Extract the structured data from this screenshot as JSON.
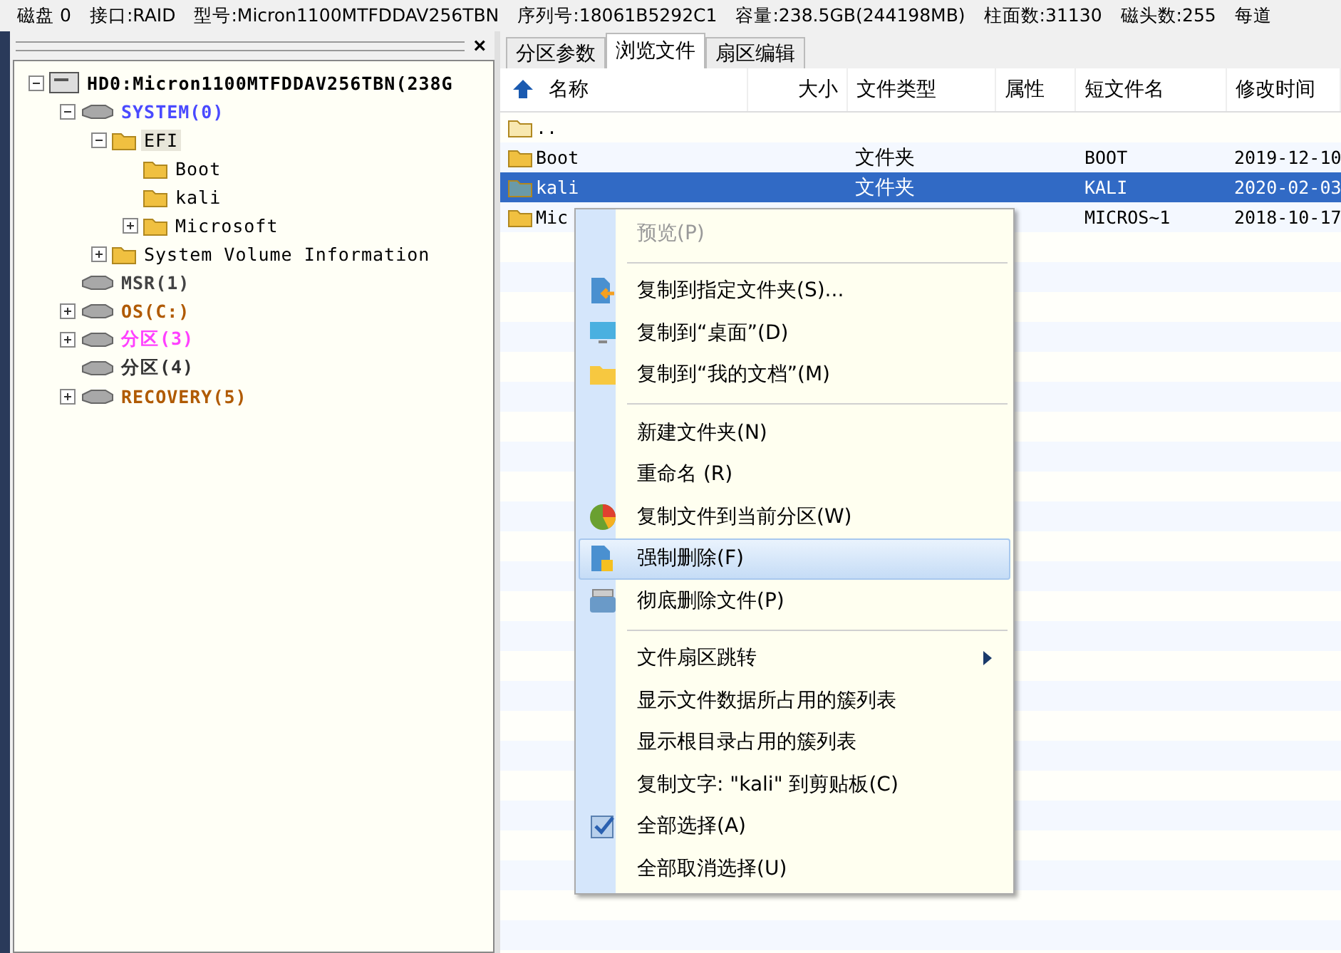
{
  "disk_info": [
    "磁盘 0",
    "接口:RAID",
    "型号:Micron1100MTFDDAV256TBN",
    "序列号:18061B5292C1",
    "容量:238.5GB(244198MB)",
    "柱面数:31130",
    "磁头数:255",
    "每道"
  ],
  "left_panel": {
    "close": "×"
  },
  "tree": [
    {
      "label": "HD0:Micron1100MTFDDAV256TBN(238G",
      "kind": "disk",
      "expanded": true,
      "selected": false,
      "children": [
        {
          "label": "SYSTEM(0)",
          "kind": "partition",
          "color": "#4a4aff",
          "expanded": true,
          "selected": false,
          "children": [
            {
              "label": "EFI",
              "kind": "folder",
              "expanded": true,
              "selected": true,
              "children": [
                {
                  "label": "Boot",
                  "kind": "folder",
                  "selected": false
                },
                {
                  "label": "kali",
                  "kind": "folder",
                  "selected": false
                },
                {
                  "label": "Microsoft",
                  "kind": "folder",
                  "expanded": false,
                  "selected": false
                }
              ]
            },
            {
              "label": "System Volume Information",
              "kind": "folder",
              "expanded": false,
              "selected": false
            }
          ]
        },
        {
          "label": "MSR(1)",
          "kind": "partition",
          "color": "#444444",
          "selected": false
        },
        {
          "label": "OS(C:)",
          "kind": "partition",
          "color": "#b05a00",
          "expanded": false,
          "selected": false
        },
        {
          "label": "分区(3)",
          "kind": "partition",
          "color": "#ff40ff",
          "expanded": false,
          "selected": false
        },
        {
          "label": "分区(4)",
          "kind": "partition",
          "color": "#333333",
          "selected": false
        },
        {
          "label": "RECOVERY(5)",
          "kind": "partition",
          "color": "#b05a00",
          "expanded": false,
          "selected": false
        }
      ]
    }
  ],
  "tabs": [
    {
      "label": "分区参数",
      "selected": false
    },
    {
      "label": "浏览文件",
      "selected": true
    },
    {
      "label": "扇区编辑",
      "selected": false
    }
  ],
  "table": {
    "columns": [
      "名称",
      "大小",
      "文件类型",
      "属性",
      "短文件名",
      "修改时间"
    ],
    "rows": [
      {
        "name": "..",
        "kind": "parent",
        "selected": false
      },
      {
        "name": "Boot",
        "kind": "folder",
        "type": "文件夹",
        "short_name": "BOOT",
        "modified": "2019-12-10",
        "selected": false
      },
      {
        "name": "kali",
        "kind": "folder",
        "type": "文件夹",
        "short_name": "KALI",
        "modified": "2020-02-03",
        "selected": true
      },
      {
        "name": "Mic",
        "kind": "folder",
        "short_name": "MICROS~1",
        "modified": "2018-10-17",
        "selected": false
      }
    ]
  },
  "context_menu": [
    {
      "kind": "item",
      "label": "预览(P)",
      "disabled": true,
      "selected": false
    },
    {
      "kind": "separator"
    },
    {
      "kind": "item",
      "label": "复制到指定文件夹(S)...",
      "disabled": false,
      "selected": false
    },
    {
      "kind": "item",
      "label": "复制到“桌面”(D)",
      "disabled": false,
      "selected": false
    },
    {
      "kind": "item",
      "label": "复制到“我的文档”(M)",
      "disabled": false,
      "selected": false
    },
    {
      "kind": "separator"
    },
    {
      "kind": "item",
      "label": "新建文件夹(N)",
      "disabled": false,
      "selected": false
    },
    {
      "kind": "item",
      "label": "重命名 (R)",
      "disabled": false,
      "selected": false
    },
    {
      "kind": "item",
      "label": "复制文件到当前分区(W)",
      "disabled": false,
      "selected": false
    },
    {
      "kind": "item",
      "label": "强制删除(F)",
      "disabled": false,
      "selected": true
    },
    {
      "kind": "item",
      "label": "彻底删除文件(P)",
      "disabled": false,
      "selected": false
    },
    {
      "kind": "separator"
    },
    {
      "kind": "submenu",
      "label": "文件扇区跳转",
      "disabled": false,
      "selected": false
    },
    {
      "kind": "item",
      "label": "显示文件数据所占用的簇列表",
      "disabled": false,
      "selected": false
    },
    {
      "kind": "item",
      "label": "显示根目录占用的簇列表",
      "disabled": false,
      "selected": false
    },
    {
      "kind": "item",
      "label": "复制文字: \"kali\" 到剪贴板(C)",
      "disabled": false,
      "selected": false
    },
    {
      "kind": "item",
      "label": "全部选择(A)",
      "disabled": false,
      "selected": false
    },
    {
      "kind": "item",
      "label": "全部取消选择(U)",
      "disabled": false,
      "selected": false
    }
  ]
}
